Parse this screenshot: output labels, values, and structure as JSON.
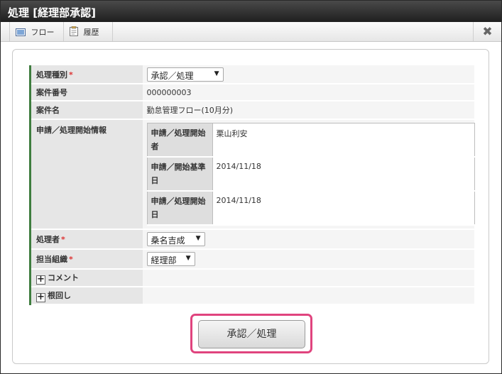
{
  "window": {
    "title": "処理 [経理部承認]"
  },
  "toolbar": {
    "flow_label": "フロー",
    "history_label": "履歴",
    "close_label": "✖"
  },
  "form": {
    "process_type": {
      "label": "処理種別",
      "required_mark": "*",
      "value": "承認／処理"
    },
    "case_number": {
      "label": "案件番号",
      "value": "000000003"
    },
    "case_name": {
      "label": "案件名",
      "value": "勤怠管理フロー(10月分)"
    },
    "request_info": {
      "label": "申請／処理開始情報",
      "rows": [
        {
          "label": "申請／処理開始者",
          "value": "栗山利安"
        },
        {
          "label": "申請／開始基準日",
          "value": "2014/11/18"
        },
        {
          "label": "申請／処理開始日",
          "value": "2014/11/18"
        }
      ]
    },
    "processor": {
      "label": "処理者",
      "required_mark": "*",
      "value": "桑名吉成"
    },
    "org": {
      "label": "担当組織",
      "required_mark": "*",
      "value": "経理部"
    },
    "comment": {
      "label": "コメント"
    },
    "nemawashi": {
      "label": "根回し"
    }
  },
  "submit": {
    "label": "承認／処理"
  },
  "colors": {
    "accent_highlight": "#e0447e",
    "label_border": "#3f7d3f",
    "title_bar": "#2a2a2a"
  }
}
